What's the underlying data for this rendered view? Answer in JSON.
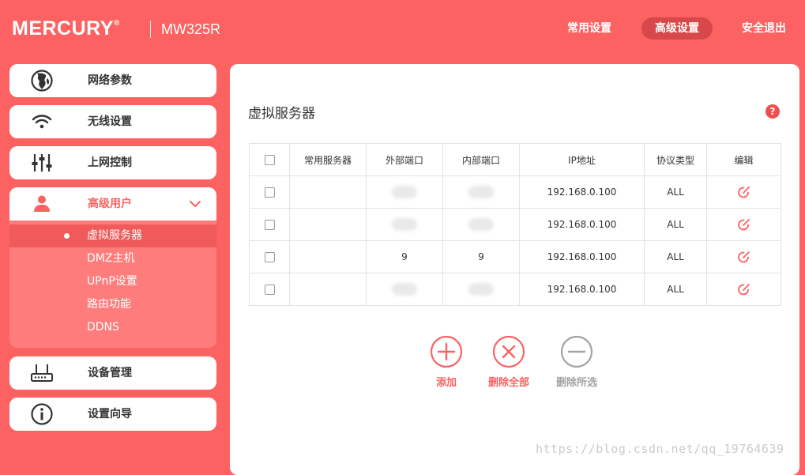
{
  "header": {
    "brand": "MERCURY",
    "brand_mark": "®",
    "model": "MW325R",
    "nav": {
      "common": "常用设置",
      "advanced": "高级设置",
      "logout": "安全退出"
    }
  },
  "sidebar": {
    "items": [
      {
        "label": "网络参数",
        "icon": "globe-icon"
      },
      {
        "label": "无线设置",
        "icon": "wifi-icon"
      },
      {
        "label": "上网控制",
        "icon": "sliders-icon"
      },
      {
        "label": "高级用户",
        "icon": "user-icon"
      },
      {
        "label": "设备管理",
        "icon": "router-icon"
      },
      {
        "label": "设置向导",
        "icon": "info-icon"
      }
    ],
    "submenu": [
      "虚拟服务器",
      "DMZ主机",
      "UPnP设置",
      "路由功能",
      "DDNS"
    ]
  },
  "main": {
    "title": "虚拟服务器",
    "help_label": "?",
    "table": {
      "headers": [
        "常用服务器",
        "外部端口",
        "内部端口",
        "IP地址",
        "协议类型",
        "编辑"
      ],
      "rows": [
        {
          "service": "",
          "ext": "",
          "int": "",
          "ip": "192.168.0.100",
          "proto": "ALL"
        },
        {
          "service": "",
          "ext": "",
          "int": "",
          "ip": "192.168.0.100",
          "proto": "ALL"
        },
        {
          "service": "",
          "ext": "9",
          "int": "9",
          "ip": "192.168.0.100",
          "proto": "ALL"
        },
        {
          "service": "",
          "ext": "",
          "int": "",
          "ip": "192.168.0.100",
          "proto": "ALL"
        }
      ]
    },
    "actions": {
      "add": "添加",
      "delete_all": "删除全部",
      "delete_selected": "删除所选"
    }
  },
  "watermark": "https://blog.csdn.net/qq_19764639",
  "colors": {
    "accent": "#fb6261",
    "accent_dark": "#d8484a",
    "submenu_bg": "#fe7d7c",
    "disabled_gray": "#a3a3a3"
  }
}
